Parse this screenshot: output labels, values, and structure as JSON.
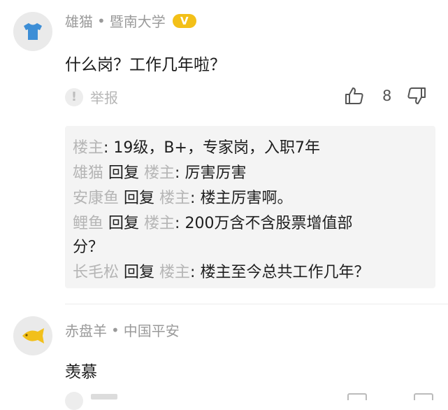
{
  "comments": [
    {
      "user": "雄猫",
      "org": "暨南大学",
      "badge": "V",
      "text": "什么岗？工作几年啦？",
      "report_label": "举报",
      "report_icon": "!",
      "like_count": "8",
      "avatar_icon": "tshirt-icon",
      "avatar_color": "#3d8ed6",
      "replies": [
        {
          "author": "楼主",
          "text": ": 19级，B+，专家岗，入职7年"
        },
        {
          "author": "雄猫",
          "verb": "回复",
          "target": "楼主",
          "text": ": 厉害厉害"
        },
        {
          "author": "安康鱼",
          "verb": "回复",
          "target": "楼主",
          "text": ": 楼主厉害啊。"
        },
        {
          "author": "鲤鱼",
          "verb": "回复",
          "target": "楼主",
          "text": ": 200万含不含股票增值部",
          "text_cont": "分？"
        },
        {
          "author": "长毛松",
          "verb": "回复",
          "target": "楼主",
          "text": ": 楼主至今总共工作几年？"
        }
      ]
    },
    {
      "user": "赤盘羊",
      "org": "中国平安",
      "text": "羡慕",
      "avatar_icon": "fish-icon",
      "avatar_color": "#f2c01a"
    }
  ],
  "separator": "•"
}
